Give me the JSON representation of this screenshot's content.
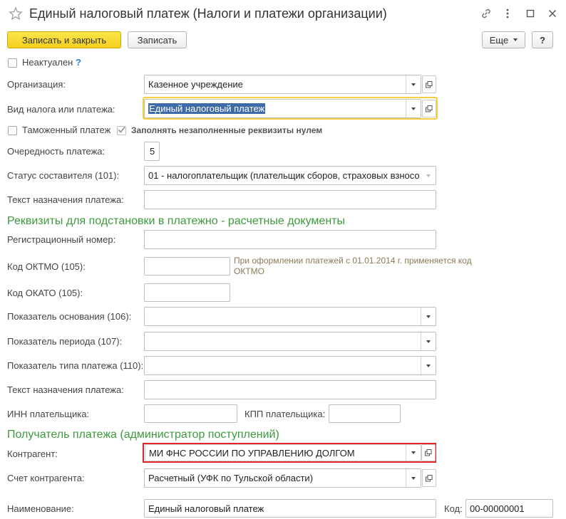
{
  "window": {
    "title": "Единый налоговый платеж (Налоги и платежи организации)"
  },
  "toolbar": {
    "save_close_label": "Записать и закрыть",
    "save_label": "Записать",
    "more_label": "Еще",
    "help_label": "?"
  },
  "inactive": {
    "label": "Неактуален",
    "help": "?",
    "checked": false
  },
  "org": {
    "label": "Организация:",
    "value": "Казенное учреждение"
  },
  "tax_type": {
    "label": "Вид налога или платежа:",
    "value": "Единый налоговый платеж"
  },
  "customs": {
    "label": "Таможенный платеж",
    "checked": false
  },
  "fill_zero": {
    "label": "Заполнять незаполненные реквизиты нулем",
    "checked": true
  },
  "priority": {
    "label": "Очередность платежа:",
    "value": "5"
  },
  "status": {
    "label": "Статус составителя (101):",
    "value": "01 - налогоплательщик (плательщик сборов, страховых взносо"
  },
  "purpose1": {
    "label": "Текст назначения платежа:",
    "value": ""
  },
  "section1": "Реквизиты для подстановки в платежно - расчетные документы",
  "reg_number": {
    "label": "Регистрационный номер:",
    "value": ""
  },
  "oktmo": {
    "label": "Код ОКТМО (105):",
    "value": "",
    "hint": "При оформлении платежей с 01.01.2014 г. применяется код ОКТМО"
  },
  "okato": {
    "label": "Код ОКАТО (105):",
    "value": ""
  },
  "basis": {
    "label": "Показатель основания (106):",
    "value": ""
  },
  "period": {
    "label": "Показатель периода (107):",
    "value": ""
  },
  "pay_type": {
    "label": "Показатель типа платежа (110):",
    "value": ""
  },
  "purpose2": {
    "label": "Текст назначения платежа:",
    "value": ""
  },
  "inn": {
    "label": "ИНН плательщика:",
    "value": ""
  },
  "kpp": {
    "label": "КПП плательщика:",
    "value": ""
  },
  "section2": "Получатель платежа (администратор поступлений)",
  "counterparty": {
    "label": "Контрагент:",
    "value": "МИ ФНС РОССИИ ПО УПРАВЛЕНИЮ ДОЛГОМ"
  },
  "account": {
    "label": "Счет контрагента:",
    "value": "Расчетный (УФК по Тульской области)"
  },
  "name": {
    "label": "Наименование:",
    "value": "Единый налоговый платеж"
  },
  "code": {
    "label": "Код:",
    "value": "00-00000001"
  }
}
